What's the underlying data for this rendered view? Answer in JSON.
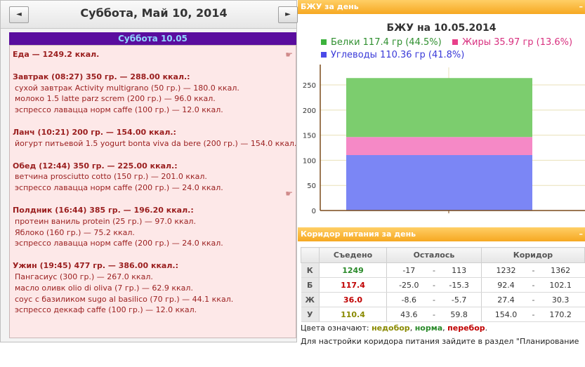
{
  "nav": {
    "prev_label": "◄",
    "next_label": "►",
    "date_title": "Суббота, Май 10, 2014"
  },
  "day": {
    "header": "Суббота 10.05",
    "total": "Еда — 1249.2 ккал.",
    "meals": [
      {
        "title": "Завтрак (08:27) 350 гр. — 288.00 ккал.:",
        "items": [
          "сухой завтрак Activity multigrano (50 гр.) — 180.0 ккал.",
          "молоко 1.5 latte parz screm (200 гр.) — 96.0 ккал.",
          "эспрессо лавацца норм caffe (100 гр.) — 12.0 ккал."
        ]
      },
      {
        "title": "Ланч (10:21) 200 гр. — 154.00 ккал.:",
        "items": [
          "йогурт питьевой 1.5 yogurt bonta viva da bere (200 гр.) — 154.0 ккал."
        ]
      },
      {
        "title": "Обед (12:44) 350 гр. — 225.00 ккал.:",
        "items": [
          "ветчина prosciutto cotto (150 гр.) — 201.0 ккал.",
          "эспрессо лавацца норм caffe (200 гр.) — 24.0 ккал."
        ]
      },
      {
        "title": "Полдник (16:44) 385 гр. — 196.20 ккал.:",
        "items": [
          "протеин ваниль protein (25 гр.) — 97.0 ккал.",
          "Яблоко (160 гр.) — 75.2 ккал.",
          "эспрессо лавацца норм caffe (200 гр.) — 24.0 ккал."
        ]
      },
      {
        "title": "Ужин (19:45) 477 гр. — 386.00 ккал.:",
        "items": [
          "Пангасиус (300 гр.) — 267.0 ккал.",
          "масло оливк olio di oliva (7 гр.) — 62.9 ккал.",
          "соус с базиликом sugo al basilico (70 гр.) — 44.1 ккал.",
          "эспрессо деккаф caffe (100 гр.) — 12.0 ккал."
        ]
      }
    ]
  },
  "bju_panel": {
    "header": "БЖУ за день",
    "minimize": "–"
  },
  "chart_data": {
    "type": "bar",
    "stacked": true,
    "title": "БЖУ на 10.05.2014",
    "legend": [
      {
        "label": "Белки 117.4 гр (44.5%)",
        "color": "#3cb23c"
      },
      {
        "label": "Жиры 35.97 гр (13.6%)",
        "color": "#e8408a"
      },
      {
        "label": "Углеводы 110.36 гр (41.8%)",
        "color": "#4a4ae8"
      }
    ],
    "categories": [
      ""
    ],
    "series": [
      {
        "name": "Углеводы",
        "values": [
          110.36
        ],
        "color": "#7b86f5"
      },
      {
        "name": "Жиры",
        "values": [
          35.97
        ],
        "color": "#f589c6"
      },
      {
        "name": "Белки",
        "values": [
          117.4
        ],
        "color": "#7ccd6e"
      }
    ],
    "yticks": [
      0,
      50,
      100,
      150,
      200,
      250
    ],
    "ylim": [
      0,
      285
    ],
    "grid": true
  },
  "corridor_panel": {
    "header": "Коридор питания за день",
    "minimize": "–",
    "columns": [
      "Съедено",
      "Осталось",
      "Коридор"
    ],
    "rows": [
      {
        "label": "К",
        "eaten": "1249",
        "eaten_color": "#2a8a2a",
        "rem_min": "-17",
        "rem_max": "113",
        "cor_min": "1232",
        "cor_max": "1362"
      },
      {
        "label": "Б",
        "eaten": "117.4",
        "eaten_color": "#c00000",
        "rem_min": "-25.0",
        "rem_max": "-15.3",
        "cor_min": "92.4",
        "cor_max": "102.1"
      },
      {
        "label": "Ж",
        "eaten": "36.0",
        "eaten_color": "#c00000",
        "rem_min": "-8.6",
        "rem_max": "-5.7",
        "cor_min": "27.4",
        "cor_max": "30.3"
      },
      {
        "label": "У",
        "eaten": "110.4",
        "eaten_color": "#8a8a00",
        "rem_min": "43.6",
        "rem_max": "59.8",
        "cor_min": "154.0",
        "cor_max": "170.2"
      }
    ],
    "range_sep": "-",
    "legend_prefix": "Цвета означают: ",
    "legend_under": "недобор",
    "legend_under_color": "#8a8a00",
    "legend_norm": "норма",
    "legend_norm_color": "#2a8a2a",
    "legend_over": "перебор",
    "legend_over_color": "#c00000",
    "note": "Для настройки коридора питания зайдите в раздел \"Планирование"
  }
}
